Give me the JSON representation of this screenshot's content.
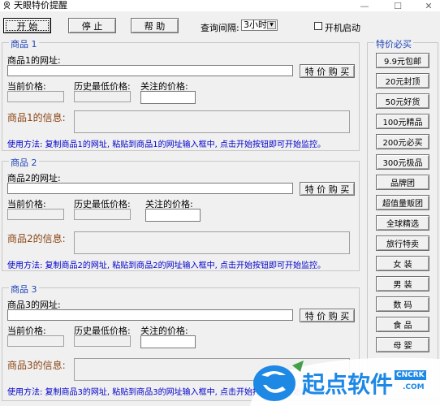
{
  "window": {
    "title": "天眼特价提醒",
    "minimize": "—",
    "maximize": "☐",
    "close": "✕"
  },
  "toolbar": {
    "start_label": "开 始",
    "stop_label": "停 止",
    "help_label": "帮 助",
    "interval_label": "查询间隔:",
    "interval_value": "3小时",
    "startup_label": "开机启动"
  },
  "products": [
    {
      "group_title": "商品 1",
      "url_label": "商品1的网址:",
      "buy_label": "特 价 购 买",
      "current_label": "当前价格:",
      "lowest_label": "历史最低价格:",
      "watch_label": "关注的价格:",
      "info_label": "商品1的信息:",
      "usage": "使用方法: 复制商品1的网址, 粘贴到商品1的网址输入框中, 点击开始按钮即可开始监控。"
    },
    {
      "group_title": "商品 2",
      "url_label": "商品2的网址:",
      "buy_label": "特 价 购 买",
      "current_label": "当前价格:",
      "lowest_label": "历史最低价格:",
      "watch_label": "关注的价格:",
      "info_label": "商品2的信息:",
      "usage": "使用方法: 复制商品2的网址, 粘贴到商品2的网址输入框中, 点击开始按钮即可开始监控。"
    },
    {
      "group_title": "商品 3",
      "url_label": "商品3的网址:",
      "buy_label": "特 价 购 买",
      "current_label": "当前价格:",
      "lowest_label": "历史最低价格:",
      "watch_label": "关注的价格:",
      "info_label": "商品3的信息:",
      "usage": "使用方法: 复制商品3的网址, 粘贴到商品3的网址输入框中, 点击开始按钮即可开始监控。"
    }
  ],
  "side": {
    "title": "特价必买",
    "buttons": [
      "9.9元包邮",
      "20元封顶",
      "50元好货",
      "100元精品",
      "200元必买",
      "300元极品",
      "品牌团",
      "超值量贩团",
      "全球精选",
      "旅行特卖",
      "女 装",
      "男 装",
      "数 码",
      "食 品",
      "母 婴"
    ]
  },
  "watermark": {
    "brand": "起点软件",
    "domain_top": "CNCRK",
    "domain_bottom": ".COM"
  }
}
